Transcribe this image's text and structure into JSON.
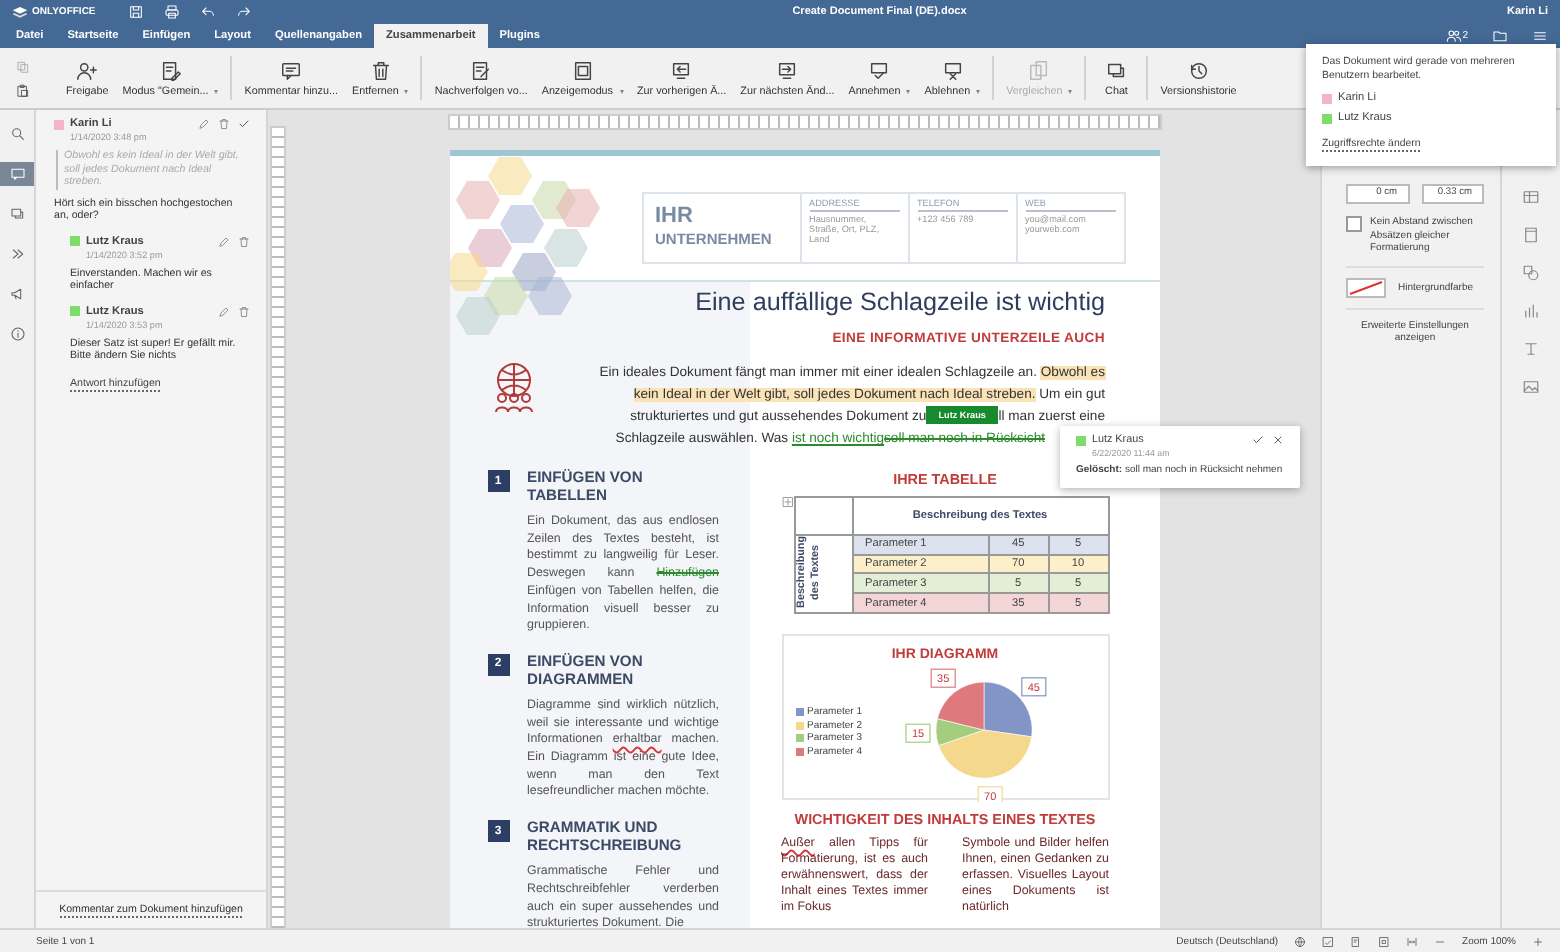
{
  "title_bar": {
    "logo": "ONLYOFFICE",
    "document_title": "Create Document Final (DE).docx",
    "user": "Karin Li",
    "users_count": "2"
  },
  "menu_tabs": [
    {
      "label": "Datei",
      "selected": false
    },
    {
      "label": "Startseite",
      "selected": false
    },
    {
      "label": "Einfügen",
      "selected": false
    },
    {
      "label": "Layout",
      "selected": false
    },
    {
      "label": "Quellenangaben",
      "selected": false
    },
    {
      "label": "Zusammenarbeit",
      "selected": true
    },
    {
      "label": "Plugins",
      "selected": false
    }
  ],
  "toolbar": {
    "groups": [
      [
        {
          "kind": "share",
          "label": "Freigabe",
          "dropdown": false,
          "disabled": false
        },
        {
          "kind": "mode",
          "label": "Modus \"Gemein...",
          "dropdown": true,
          "disabled": false
        }
      ],
      [
        {
          "kind": "comment",
          "label": "Kommentar hinzu...",
          "dropdown": false,
          "disabled": false
        },
        {
          "kind": "trash",
          "label": "Entfernen",
          "dropdown": true,
          "disabled": false
        }
      ],
      [
        {
          "kind": "track",
          "label": "Nachverfolgen vo...",
          "dropdown": false,
          "disabled": false
        },
        {
          "kind": "display",
          "label": "Anzeigemodus",
          "dropdown": true,
          "disabled": false
        },
        {
          "kind": "prev",
          "label": "Zur vorherigen Ä...",
          "dropdown": false,
          "disabled": false
        },
        {
          "kind": "next",
          "label": "Zur nächsten Änd...",
          "dropdown": false,
          "disabled": false
        },
        {
          "kind": "accept",
          "label": "Annehmen",
          "dropdown": true,
          "disabled": false
        },
        {
          "kind": "reject",
          "label": "Ablehnen",
          "dropdown": true,
          "disabled": false
        }
      ],
      [
        {
          "kind": "compare",
          "label": "Vergleichen",
          "dropdown": true,
          "disabled": true
        }
      ],
      [
        {
          "kind": "chat",
          "label": "Chat",
          "dropdown": false,
          "disabled": false
        }
      ],
      [
        {
          "kind": "history",
          "label": "Versionshistorie",
          "dropdown": false,
          "disabled": false
        }
      ]
    ]
  },
  "left_rail": [
    {
      "kind": "search",
      "selected": false
    },
    {
      "kind": "comments",
      "selected": true
    },
    {
      "kind": "chat",
      "selected": false
    },
    {
      "kind": "navigation",
      "selected": false
    },
    {
      "kind": "feedback",
      "selected": false
    },
    {
      "kind": "about",
      "selected": false
    }
  ],
  "comments": [
    {
      "author": "Karin Li",
      "color": "#f2b3cb",
      "date": "1/14/2020 3:48 pm",
      "quote": "Obwohl es kein Ideal in der Welt gibt, soll jedes Dokument nach Ideal streben.",
      "text": "Hört sich ein bisschen hochgestochen an, oder?",
      "replies": [
        {
          "author": "Lutz Kraus",
          "color": "#7ddc6a",
          "date": "1/14/2020 3:52 pm",
          "text": "Einverstanden. Machen wir es einfacher"
        },
        {
          "author": "Lutz Kraus",
          "color": "#7ddc6a",
          "date": "1/14/2020 3:53 pm",
          "text": "Dieser Satz ist super! Er gefällt mir. Bitte ändern Sie nichts"
        }
      ],
      "add_reply": "Antwort hinzufügen"
    }
  ],
  "add_document_comment": "Kommentar zum Dokument hinzufügen",
  "document": {
    "header": {
      "company_line1": "IHR",
      "company_line2": "UNTERNEHMEN",
      "contacts": [
        {
          "label": "ADDRESSE",
          "lines": [
            "Hausnummer,",
            "Straße, Ort, PLZ,",
            "Land"
          ]
        },
        {
          "label": "TELEFON",
          "lines": [
            "+123 456 789"
          ]
        },
        {
          "label": "WEB",
          "lines": [
            "you@mail.com",
            "yourweb.com"
          ]
        }
      ]
    },
    "headline": "Eine auffällige Schlagzeile ist wichtig",
    "subheadline": "EINE INFORMATIVE UNTERZEILE AUCH",
    "intro": {
      "before": [
        {
          "kind": "plain",
          "text": "Ein ideales Dokument fängt man immer mit einer idealen Schlagzeile an. "
        },
        {
          "kind": "highlight",
          "text": "Obwohl es kein Ideal in der Welt gibt, soll jedes Dokument nach Ideal streben."
        },
        {
          "kind": "plain",
          "text": " Um ein gut strukturiertes und gut aussehendes Dokument zu"
        }
      ],
      "tag": "Lutz Kraus",
      "after": [
        {
          "kind": "plain",
          "text": "ll man zuerst eine Schlagzeile auswählen. Was "
        },
        {
          "kind": "insert",
          "text": "ist noch wichtig"
        },
        {
          "kind": "delete",
          "text": "soll man noch in Rücksicht"
        }
      ]
    },
    "sections": [
      {
        "number": "1",
        "title": "EINFÜGEN VON TABELLEN",
        "text": [
          {
            "kind": "plain",
            "text": "Ein Dokument, das aus endlosen Zeilen des Textes besteht, ist bestimmt zu langweilig für Leser. Deswegen kann "
          },
          {
            "kind": "delete",
            "text": "Hinzufügen"
          },
          {
            "kind": "plain",
            "text": " Einfügen von Tabellen helfen, die Information visuell besser zu gruppieren."
          }
        ]
      },
      {
        "number": "2",
        "title": "EINFÜGEN VON DIAGRAMMEN",
        "text": [
          {
            "kind": "plain",
            "text": "Diagramme sind wirklich nützlich, weil sie interessante und wichtige Informationen "
          },
          {
            "kind": "misspelled",
            "text": "erhaltbar"
          },
          {
            "kind": "plain",
            "text": " machen. Ein Diagramm ist eine gute Idee, wenn man den Text lesefreundlicher machen möchte."
          }
        ]
      },
      {
        "number": "3",
        "title": "GRAMMATIK UND RECHTSCHREIBUNG",
        "text": [
          {
            "kind": "plain",
            "text": "Grammatische Fehler und Rechtschreibfehler verderben auch ein super aussehendes und strukturiertes Dokument. Die"
          }
        ]
      }
    ],
    "table_title": "IHRE TABELLE",
    "table": {
      "column_header": "Beschreibung des Textes",
      "row_header": "Beschreibung des Textes",
      "rows": [
        {
          "cells": [
            "Parameter 1",
            "45",
            "5"
          ],
          "color": "#dde1ee"
        },
        {
          "cells": [
            "Parameter 2",
            "70",
            "10"
          ],
          "color": "#fcefc9"
        },
        {
          "cells": [
            "Parameter 3",
            "5",
            "5"
          ],
          "color": "#e2efd6"
        },
        {
          "cells": [
            "Parameter 4",
            "35",
            "5"
          ],
          "color": "#f3d5d5"
        }
      ]
    },
    "chart": {
      "chart_data": {
        "type": "pie",
        "title": "IHR DIAGRAMM",
        "categories": [
          "Parameter 1",
          "Parameter 2",
          "Parameter 3",
          "Parameter 4"
        ],
        "values": [
          45,
          70,
          15,
          35
        ],
        "data_labels": true,
        "legend": "left"
      }
    },
    "content_title": "WICHTIGKEIT DES INHALTS EINES TEXTES",
    "content_columns": [
      [
        {
          "kind": "misspelled",
          "text": "Außer"
        },
        {
          "kind": "plain",
          "text": " allen Tipps für Formatierung, ist es auch erwähnenswert, dass der Inhalt eines Textes immer im Fokus"
        }
      ],
      [
        {
          "kind": "plain",
          "text": "Symbole und Bilder helfen Ihnen, einen Gedanken zu erfassen. Visuelles Layout eines Dokuments ist natürlich"
        }
      ]
    ]
  },
  "paragraph_settings": {
    "spacing_values": [
      "0 cm",
      "0.33 cm"
    ],
    "no_spacing": {
      "label": "Kein Abstand zwischen Absätzen gleicher Formatierung",
      "checked": false
    },
    "background": {
      "label": "Hintergrundfarbe"
    },
    "advanced_link": "Erweiterte Einstellungen anzeigen"
  },
  "status_bar": {
    "page": "Seite 1 von 1",
    "language": "Deutsch (Deutschland)",
    "zoom": "Zoom 100%"
  },
  "users_popover": {
    "message": "Das Dokument wird gerade von mehreren Benutzern bearbeitet.",
    "users": [
      {
        "name": "Karin Li",
        "color": "#f2b3cb"
      },
      {
        "name": "Lutz Kraus",
        "color": "#7ddc6a"
      }
    ],
    "link": "Zugriffsrechte ändern"
  },
  "change_popup": {
    "author": "Lutz Kraus",
    "color": "#7ddc6a",
    "date": "6/22/2020 11:44 am",
    "text": "**Gelöscht:** soll man noch in Rücksicht nehmen"
  }
}
